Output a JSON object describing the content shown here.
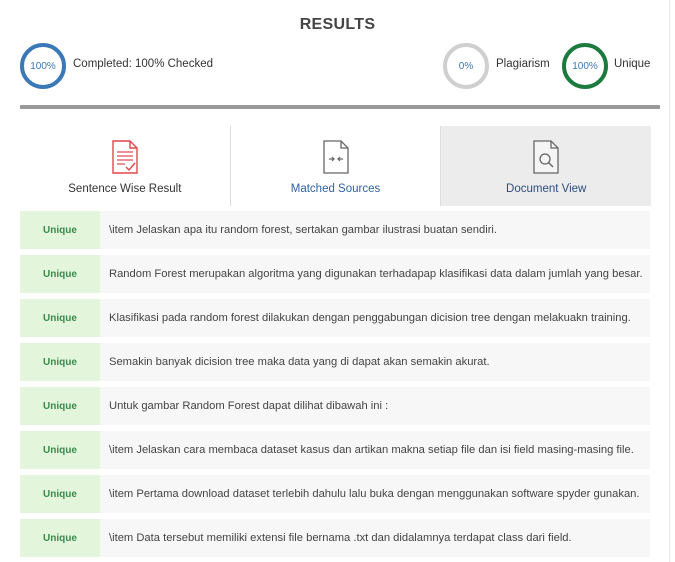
{
  "header": {
    "title": "RESULTS"
  },
  "stats": {
    "completed": {
      "ring_value": "100%",
      "label": "Completed: 100% Checked",
      "color": "#3b78b8"
    },
    "plagiarism": {
      "ring_value": "0%",
      "label": "Plagiarism",
      "color": "#cfcfcf"
    },
    "unique": {
      "ring_value": "100%",
      "label": "Unique",
      "color": "#1d7a3e"
    }
  },
  "tabs": [
    {
      "label": "Sentence Wise Result",
      "icon": "document-check-icon",
      "active": false
    },
    {
      "label": "Matched Sources",
      "icon": "document-compare-icon",
      "active": false
    },
    {
      "label": "Document View",
      "icon": "document-search-icon",
      "active": true
    }
  ],
  "results": [
    {
      "status": "Unique",
      "text": "\\item Jelaskan apa itu random forest, sertakan gambar ilustrasi buatan sendiri."
    },
    {
      "status": "Unique",
      "text": "Random Forest merupakan algoritma yang digunakan terhadapap klasifikasi data dalam jumlah yang besar."
    },
    {
      "status": "Unique",
      "text": "Klasifikasi pada random forest dilakukan dengan penggabungan dicision tree dengan melakuakn training."
    },
    {
      "status": "Unique",
      "text": "Semakin banyak dicision tree maka data yang di dapat akan semakin akurat."
    },
    {
      "status": "Unique",
      "text": "Untuk gambar Random Forest dapat dilihat dibawah ini :"
    },
    {
      "status": "Unique",
      "text": "\\item Jelaskan cara membaca dataset kasus dan artikan makna setiap file dan isi field masing-masing file."
    },
    {
      "status": "Unique",
      "text": "\\item Pertama download dataset terlebih dahulu lalu buka dengan menggunakan software spyder gunakan."
    },
    {
      "status": "Unique",
      "text": "\\item Data tersebut memiliki extensi file bernama .txt dan didalamnya terdapat class dari field."
    }
  ]
}
